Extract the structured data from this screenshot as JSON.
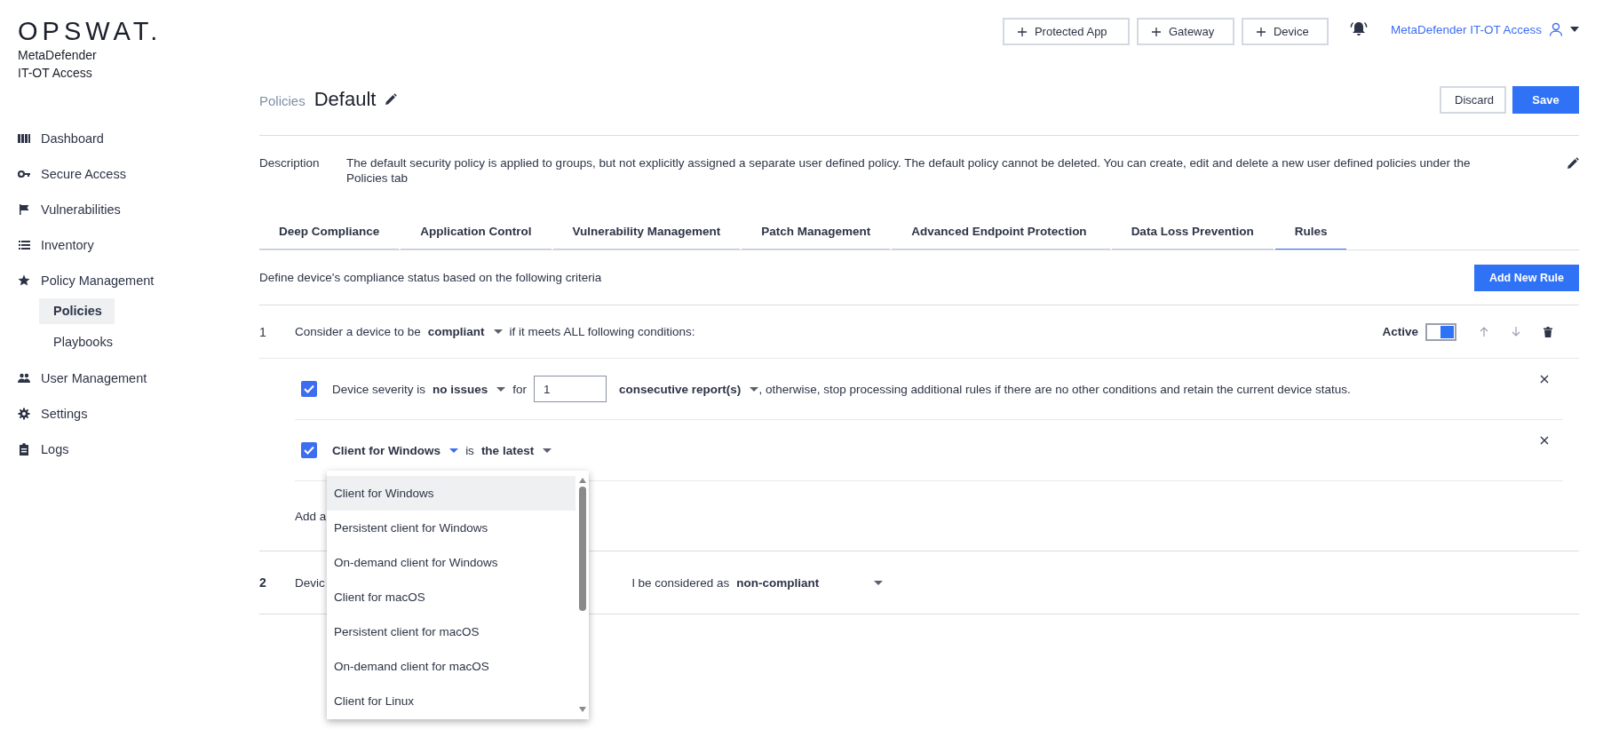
{
  "logo": {
    "brand": "OPSWAT.",
    "product_lines": [
      "MetaDefender",
      "IT-OT Access"
    ]
  },
  "sidebar": {
    "items": [
      {
        "label": "Dashboard",
        "selected": false
      },
      {
        "label": "Secure Access",
        "selected": false
      },
      {
        "label": "Vulnerabilities",
        "selected": false
      },
      {
        "label": "Inventory",
        "selected": false
      },
      {
        "label": "Policy Management",
        "selected": false,
        "children": [
          {
            "label": "Policies",
            "selected": true
          },
          {
            "label": "Playbooks",
            "selected": false
          }
        ]
      },
      {
        "label": "User Management",
        "selected": false
      },
      {
        "label": "Settings",
        "selected": false
      },
      {
        "label": "Logs",
        "selected": false
      }
    ]
  },
  "top_bar": {
    "add_buttons": [
      "Protected App",
      "Gateway",
      "Device"
    ],
    "user": "MetaDefender IT-OT Access"
  },
  "header": {
    "breadcrumb": "Policies",
    "title": "Default",
    "buttons": [
      {
        "label": "Discard",
        "kind": "secondary"
      },
      {
        "label": "Save",
        "kind": "primary"
      }
    ]
  },
  "description": {
    "label": "Description",
    "text": "The default security policy is applied to groups, but not explicitly assigned a separate user defined policy. The default policy cannot be deleted. You can create, edit and delete a new user defined policies under the Policies tab"
  },
  "tabs": [
    {
      "label": "Deep Compliance",
      "selected": false
    },
    {
      "label": "Application Control",
      "selected": false
    },
    {
      "label": "Vulnerability Management",
      "selected": false
    },
    {
      "label": "Patch Management",
      "selected": false
    },
    {
      "label": "Advanced Endpoint Protection",
      "selected": false
    },
    {
      "label": "Data Loss Prevention",
      "selected": false
    },
    {
      "label": "Rules",
      "selected": true
    }
  ],
  "rules_intro": {
    "text": "Define device's compliance status based on the following criteria",
    "button": "Add New Rule"
  },
  "rules": [
    {
      "kind": "conditional",
      "number": "1",
      "prefix": "Consider a device to be",
      "status": {
        "value": "compliant",
        "open": false
      },
      "suffix": "if it meets ALL following conditions:",
      "active_label": "Active",
      "active": true,
      "conditions": [
        {
          "kind": "severity",
          "checked": true,
          "label": "Device severity is",
          "severity": {
            "value": "no issues",
            "open": false
          },
          "for_label": "for",
          "count": "1",
          "unit": {
            "value": "consecutive report(s)",
            "open": false
          },
          "tail": ", otherwise, stop processing additional rules if there are no other conditions and retain the current device status."
        },
        {
          "kind": "client",
          "checked": true,
          "client": {
            "value": "Client for Windows",
            "open": true
          },
          "is_label": "is",
          "version": {
            "value": "the latest",
            "open": false
          }
        }
      ],
      "add_link": "Add a"
    },
    {
      "kind": "default",
      "number": "2",
      "text_start": "Devic",
      "text_end": "l be considered as",
      "status": {
        "value": "non-compliant",
        "open": false
      }
    }
  ],
  "dropdown": {
    "options": [
      {
        "label": "Client for Windows",
        "selected": true
      },
      {
        "label": "Persistent client for Windows",
        "selected": false
      },
      {
        "label": "On-demand client for Windows",
        "selected": false
      },
      {
        "label": "Client for macOS",
        "selected": false
      },
      {
        "label": "Persistent client for macOS",
        "selected": false
      },
      {
        "label": "On-demand client for macOS",
        "selected": false
      },
      {
        "label": "Client for Linux",
        "selected": false
      }
    ]
  }
}
